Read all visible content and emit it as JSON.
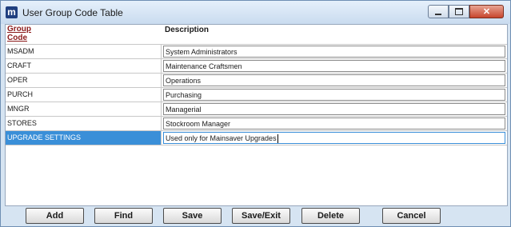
{
  "window": {
    "title": "User Group Code Table",
    "icon": "m",
    "controls": [
      "minimize-icon",
      "maximize-icon",
      "close-icon"
    ]
  },
  "grid": {
    "columns": {
      "code_line1": "Group",
      "code_line2": "Code",
      "description": "Description"
    },
    "rows": [
      {
        "code": "MSADM",
        "description": "System Administrators"
      },
      {
        "code": "CRAFT",
        "description": "Maintenance Craftsmen"
      },
      {
        "code": "OPER",
        "description": "Operations"
      },
      {
        "code": "PURCH",
        "description": "Purchasing"
      },
      {
        "code": "MNGR",
        "description": "Managerial"
      },
      {
        "code": "STORES",
        "description": "Stockroom Manager"
      },
      {
        "code": "UPGRADE SETTINGS",
        "description": "Used only for Mainsaver Upgrades",
        "selected": true
      }
    ]
  },
  "buttons": {
    "add": "Add",
    "find": "Find",
    "save": "Save",
    "save_exit": "Save/Exit",
    "delete": "Delete",
    "cancel": "Cancel"
  },
  "colors": {
    "selection": "#3a8fd8",
    "header_code": "#8b1a1a",
    "window_bg": "#d6e4f2"
  }
}
